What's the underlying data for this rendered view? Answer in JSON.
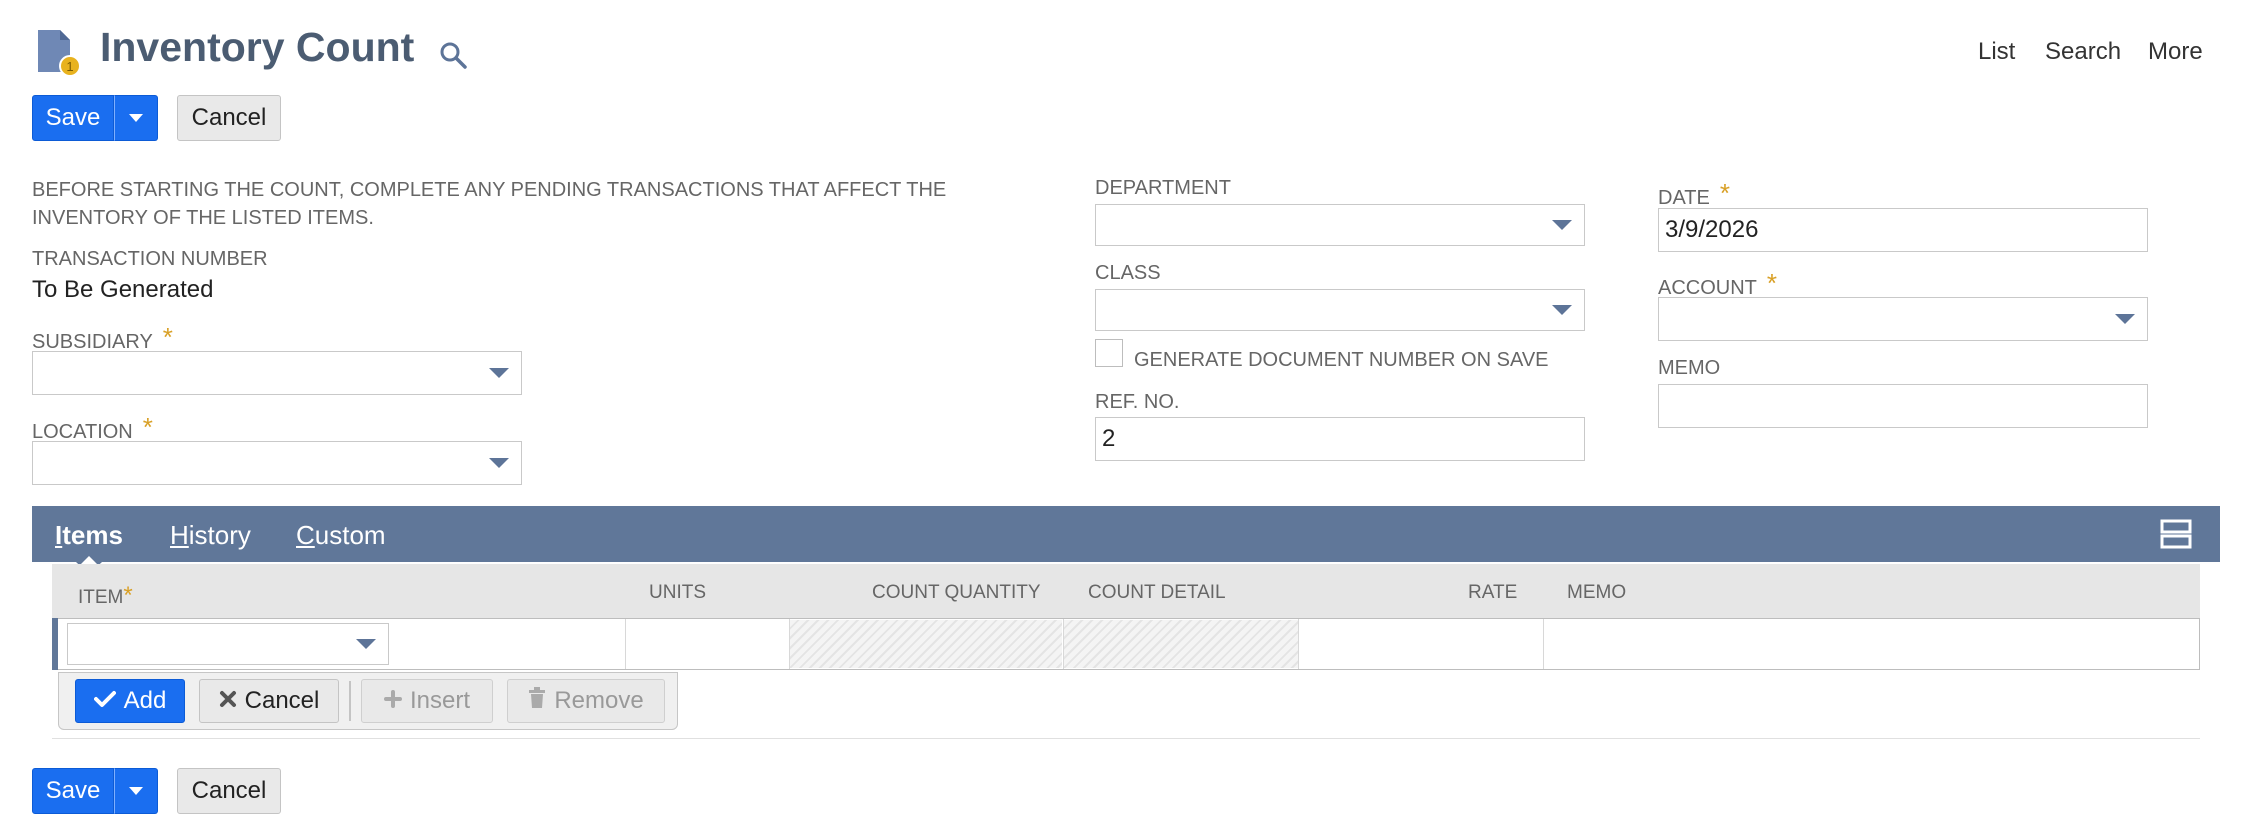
{
  "header": {
    "title": "Inventory Count",
    "nav": [
      "List",
      "Search",
      "More"
    ],
    "icons": {
      "page": "document-coin-icon",
      "search": "search-icon"
    }
  },
  "buttons": {
    "save": "Save",
    "cancel": "Cancel"
  },
  "form": {
    "notice": "BEFORE STARTING THE COUNT, COMPLETE ANY PENDING TRANSACTIONS THAT AFFECT THE INVENTORY OF THE LISTED ITEMS.",
    "transaction_number": {
      "label": "TRANSACTION NUMBER",
      "value": "To Be Generated"
    },
    "subsidiary": {
      "label": "SUBSIDIARY",
      "value": "",
      "required": "*"
    },
    "location": {
      "label": "LOCATION",
      "value": "",
      "required": "*"
    },
    "department": {
      "label": "DEPARTMENT",
      "value": ""
    },
    "class": {
      "label": "CLASS",
      "value": ""
    },
    "generate_doc": {
      "label": "GENERATE DOCUMENT NUMBER ON SAVE",
      "checked": false
    },
    "ref_no": {
      "label": "REF. NO.",
      "value": "2"
    },
    "date": {
      "label": "DATE",
      "value": "3/9/2026",
      "required": "*"
    },
    "account": {
      "label": "ACCOUNT",
      "value": "",
      "required": "*"
    },
    "memo": {
      "label": "MEMO",
      "value": ""
    }
  },
  "tabs": [
    {
      "label": "Items",
      "key": "I",
      "rest": "tems",
      "active": true
    },
    {
      "label": "History",
      "key": "H",
      "rest": "istory",
      "active": false
    },
    {
      "label": "Custom",
      "key": "C",
      "rest": "ustom",
      "active": false
    }
  ],
  "grid": {
    "columns": [
      "ITEM",
      "UNITS",
      "COUNT QUANTITY",
      "COUNT DETAIL",
      "RATE",
      "MEMO"
    ],
    "item_required": "*",
    "row": {
      "item": "",
      "units": "",
      "count_quantity": "",
      "count_detail": "",
      "rate": "",
      "memo": ""
    },
    "actions": {
      "add": "Add",
      "cancel": "Cancel",
      "insert": "Insert",
      "remove": "Remove"
    }
  },
  "colors": {
    "accent": "#1a6ef0",
    "tab_bar": "#607799",
    "title": "#4b5c72",
    "required": "#d9a026"
  }
}
